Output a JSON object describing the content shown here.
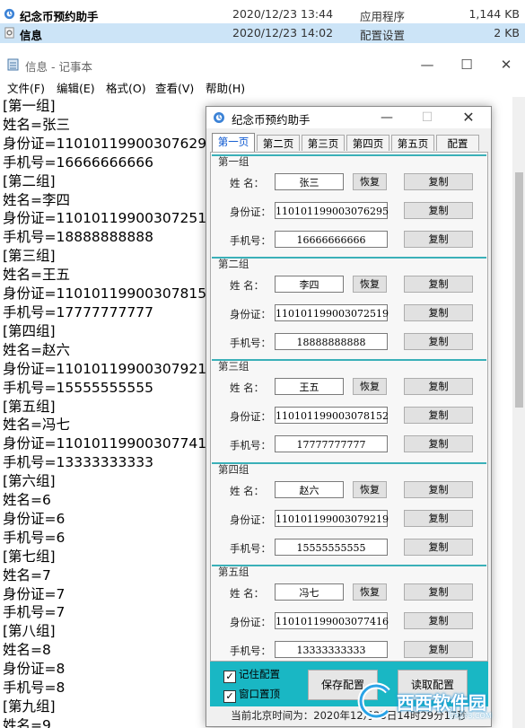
{
  "explorer": {
    "rows": [
      {
        "name": "纪念币预约助手",
        "date": "2020/12/23 13:44",
        "type": "应用程序",
        "size": "1,144 KB",
        "icon": "app-icon"
      },
      {
        "name": "信息",
        "date": "2020/12/23 14:02",
        "type": "配置设置",
        "size": "2 KB",
        "icon": "config-file-icon"
      }
    ]
  },
  "notepad": {
    "title": "信息 - 记事本",
    "controls": {
      "min": "—",
      "max": "☐",
      "close": "✕"
    },
    "menu": [
      "文件(F)",
      "编辑(E)",
      "格式(O)",
      "查看(V)",
      "帮助(H)"
    ],
    "lines": [
      "[第一组]",
      "姓名=张三",
      "身份证=110101199003076295",
      "手机号=16666666666",
      "[第二组]",
      "姓名=李四",
      "身份证=110101199003072519",
      "手机号=18888888888",
      "[第三组]",
      "姓名=王五",
      "身份证=110101199003078152",
      "手机号=17777777777",
      "[第四组]",
      "姓名=赵六",
      "身份证=110101199003079219",
      "手机号=15555555555",
      "[第五组]",
      "姓名=冯七",
      "身份证=110101199003077416",
      "手机号=13333333333",
      "[第六组]",
      "姓名=6",
      "身份证=6",
      "手机号=6",
      "[第七组]",
      "姓名=7",
      "身份证=7",
      "手机号=7",
      "[第八组]",
      "姓名=8",
      "身份证=8",
      "手机号=8",
      "[第九组]",
      "姓名=9"
    ]
  },
  "app": {
    "title": "纪念币预约助手",
    "controls": {
      "min": "—",
      "max": "☐",
      "close": "✕"
    },
    "tabs": [
      "第一页",
      "第二页",
      "第三页",
      "第四页",
      "第五页",
      "配置"
    ],
    "active_tab": 0,
    "labels": {
      "name": "姓  名：",
      "id": "身份证：",
      "phone": "手机号："
    },
    "buttons": {
      "restore": "恢复",
      "copy": "复制"
    },
    "groups": [
      {
        "title": "第一组",
        "name": "张三",
        "id": "110101199003076295",
        "phone": "16666666666"
      },
      {
        "title": "第二组",
        "name": "李四",
        "id": "110101199003072519",
        "phone": "18888888888"
      },
      {
        "title": "第三组",
        "name": "王五",
        "id": "110101199003078152",
        "phone": "17777777777"
      },
      {
        "title": "第四组",
        "name": "赵六",
        "id": "110101199003079219",
        "phone": "15555555555"
      },
      {
        "title": "第五组",
        "name": "冯七",
        "id": "110101199003077416",
        "phone": "13333333333"
      }
    ],
    "options": [
      {
        "label": "记住配置",
        "checked": true
      },
      {
        "label": "窗口置顶",
        "checked": true
      }
    ],
    "save_label": "保存配置",
    "load_label": "读取配置",
    "status": "当前北京时间为：2020年12月23日14时29分17秒",
    "accent_color": "#19b7c4"
  },
  "watermark": {
    "text": "西西软件园",
    "sub": "CR173.COM"
  }
}
